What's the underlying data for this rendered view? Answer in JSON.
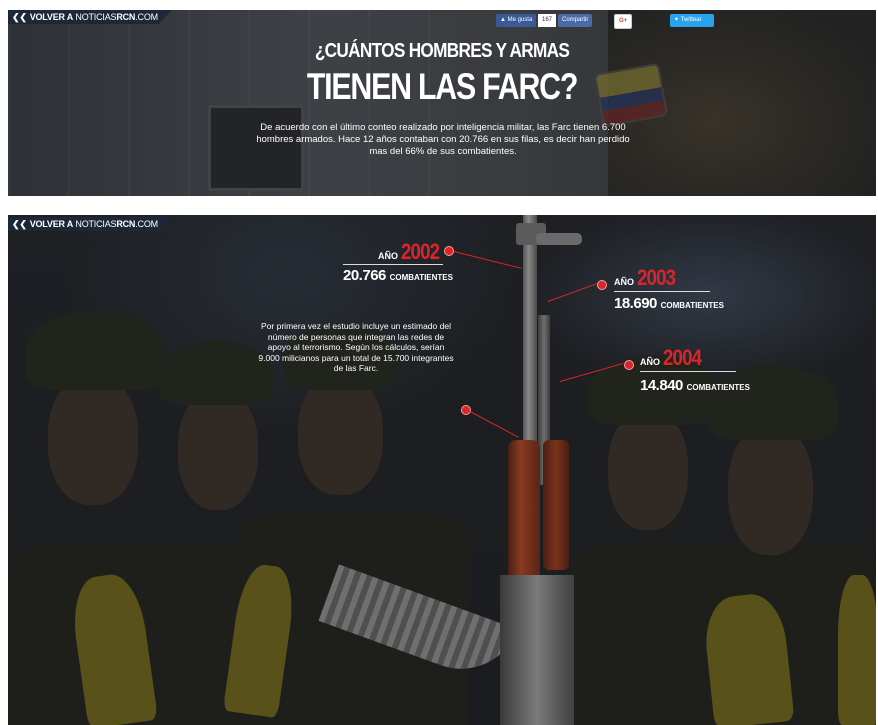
{
  "panel1": {
    "back_link": {
      "prefix": "VOLVER A",
      "site_thin": "NOTICIAS",
      "site_bold": "RCN",
      "suffix": ".COM"
    },
    "social": {
      "fb_like": "Me gusta",
      "fb_count": "167",
      "fb_share": "Compartir",
      "gplus": "G+",
      "twitter": "Twittear"
    },
    "title_small": "¿CUÁNTOS HOMBRES Y ARMAS",
    "title_big": "TIENEN LAS FARC?",
    "body": "De acuerdo con el último conteo realizado por inteligencia militar, las Farc tienen 6.700 hombres armados. Hace 12 años contaban con 20.766 en sus filas, es decir han perdido mas del 66% de sus combatientes."
  },
  "panel2": {
    "back_link": {
      "prefix": "VOLVER A",
      "site_thin": "NOTICIAS",
      "site_bold": "RCN",
      "suffix": ".COM"
    },
    "years": [
      {
        "prefix": "AÑO",
        "year": "2002",
        "count": "20.766",
        "unit": "COMBATIENTES"
      },
      {
        "prefix": "AÑO",
        "year": "2003",
        "count": "18.690",
        "unit": "COMBATIENTES"
      },
      {
        "prefix": "AÑO",
        "year": "2004",
        "count": "14.840",
        "unit": "COMBATIENTES"
      }
    ],
    "note": "Por primera vez el estudio incluye un estimado del número de personas que integran las redes de apoyo al terrorismo. Según los cálculos, serían 9.000 milicianos para un total de 15.700 integrantes de las Farc."
  },
  "colors": {
    "accent_red": "#d9252b",
    "nav_tab": "#1c2838",
    "facebook": "#3b5998",
    "twitter": "#2aa3ef"
  },
  "icons": {
    "back": "double-chevron-left-icon",
    "facebook": "thumbs-up-icon",
    "twitter": "twitter-bird-icon"
  }
}
